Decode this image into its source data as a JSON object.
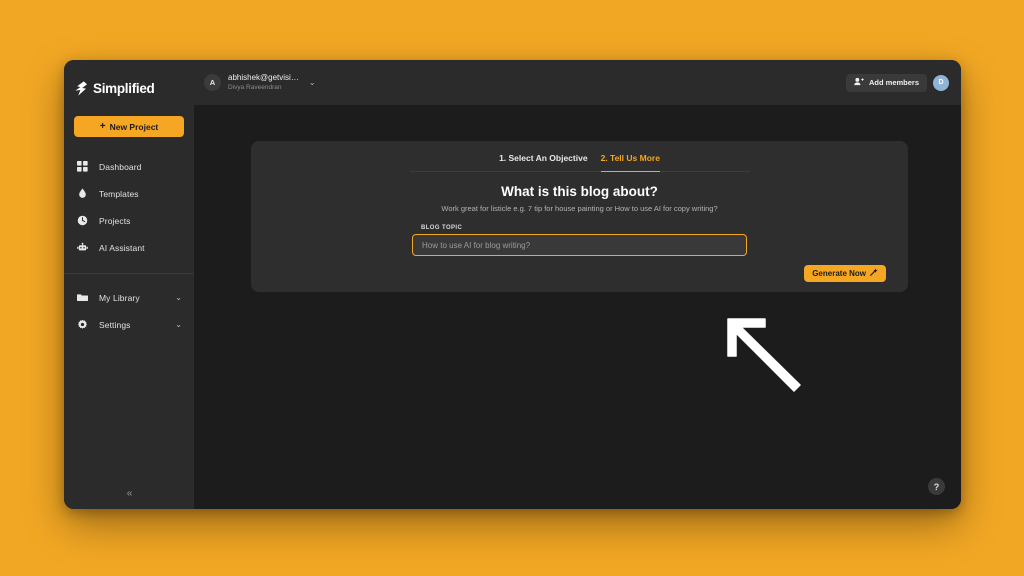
{
  "theme": {
    "page_background": "#f2a724",
    "accent": "#f5a623",
    "window_background": "#1c1c1c",
    "sidebar_background": "#2b2b2b",
    "card_background": "#2e2e2e"
  },
  "sidebar": {
    "brand": "Simplified",
    "brand_logo_icon": "simplified-logo-icon",
    "new_project_label": "New Project",
    "new_project_icon": "plus-icon",
    "items": [
      {
        "label": "Dashboard",
        "icon": "dashboard-grid-icon",
        "key": "dashboard"
      },
      {
        "label": "Templates",
        "icon": "droplet-icon",
        "key": "templates"
      },
      {
        "label": "Projects",
        "icon": "clock-icon",
        "key": "projects"
      },
      {
        "label": "AI Assistant",
        "icon": "robot-icon",
        "key": "ai-assistant"
      }
    ],
    "group_items": [
      {
        "label": "My Library",
        "icon": "folder-icon",
        "chevron": "⌄",
        "key": "my-library"
      },
      {
        "label": "Settings",
        "icon": "gear-icon",
        "chevron": "⌄",
        "key": "settings"
      }
    ],
    "collapse_icon": "«"
  },
  "topbar": {
    "avatar_initial": "A",
    "account_email": "abhishek@getvisi…",
    "account_user": "Divya Raveendran",
    "account_caret": "⌄",
    "add_members_label": "Add members",
    "add_members_icon": "add-user-icon",
    "member_badge_initial": "D"
  },
  "card": {
    "tabs": [
      {
        "label": "1. Select An Objective",
        "active": false
      },
      {
        "label": "2. Tell Us More",
        "active": true
      }
    ],
    "title": "What is this blog about?",
    "subtitle": "Work great for listicle e.g. 7 tip for house painting or How to use AI for copy writing?",
    "field_label": "BLOG TOPIC",
    "field_value": "",
    "field_placeholder": "How to use AI for blog writing?",
    "generate_label": "Generate Now",
    "generate_icon": "magic-wand-icon"
  },
  "help": {
    "label": "?",
    "icon": "question-mark-icon"
  },
  "cursor": {
    "icon": "arrow-pointer-icon",
    "direction": "up-left"
  }
}
